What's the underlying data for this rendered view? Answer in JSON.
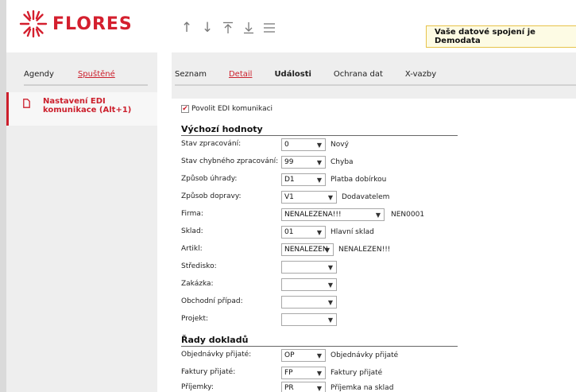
{
  "header": {
    "logo_text": "FLORES",
    "demo_text": "Vaše datové spojení je Demodata",
    "accent_color": "#cc1f2c",
    "toolbar_icons": [
      "arrow-up-icon",
      "arrow-down-icon",
      "arrow-to-top-icon",
      "arrow-to-bottom-icon",
      "menu-icon"
    ]
  },
  "left": {
    "tabs": [
      {
        "label": "Agendy",
        "active": false
      },
      {
        "label": "Spuštěné",
        "active": true
      }
    ],
    "item_label": "Nastavení EDI komunikace (Alt+1)"
  },
  "right": {
    "tabs": [
      {
        "label": "Seznam"
      },
      {
        "label": "Detail"
      },
      {
        "label": "Události"
      },
      {
        "label": "Ochrana dat"
      },
      {
        "label": "X-vazby"
      }
    ]
  },
  "form": {
    "enable_label": "Povolit EDI komunikaci",
    "enable_checked": true,
    "section_defaults": "Výchozí hodnoty",
    "section_series": "Řady dokladů",
    "defaults": [
      {
        "label": "Stav zpracování:",
        "value": "0",
        "desc": "Nový"
      },
      {
        "label": "Stav chybného zpracování:",
        "value": "99",
        "desc": "Chyba"
      },
      {
        "label": "Způsob úhrady:",
        "value": "D1",
        "desc": "Platba dobírkou"
      },
      {
        "label": "Způsob dopravy:",
        "value": "V1",
        "desc": "Dodavatelem"
      },
      {
        "label": "Firma:",
        "value": "NENALEZENA!!!",
        "desc": "NEN0001"
      },
      {
        "label": "Sklad:",
        "value": "01",
        "desc": "Hlavní sklad"
      },
      {
        "label": "Artikl:",
        "value": "NENALEZEN",
        "desc": "NENALEZEN!!!"
      },
      {
        "label": "Středisko:",
        "value": "",
        "desc": ""
      },
      {
        "label": "Zakázka:",
        "value": "",
        "desc": ""
      },
      {
        "label": "Obchodní případ:",
        "value": "",
        "desc": ""
      },
      {
        "label": "Projekt:",
        "value": "",
        "desc": ""
      }
    ],
    "series": [
      {
        "label": "Objednávky přijaté:",
        "value": "OP",
        "desc": "Objednávky přijaté"
      },
      {
        "label": "Faktury přijaté:",
        "value": "FP",
        "desc": "Faktury přijaté"
      },
      {
        "label": "Příjemky:",
        "value": "PR",
        "desc": "Příjemka na sklad"
      }
    ]
  }
}
